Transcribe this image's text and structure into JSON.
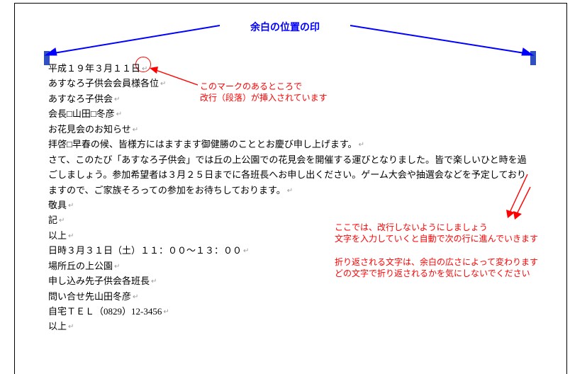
{
  "colors": {
    "blue": "#0000ff",
    "red": "#ff0000",
    "mark": "#3050c0"
  },
  "top_label": "余白の位置の印",
  "annotations": {
    "circle_note_l1": "このマークのあるところで",
    "circle_note_l2": "改行（段落）が挿入されています",
    "block_note_l1": "ここでは、改行しないようにしましょう",
    "block_note_l2": "文字を入力していくと自動で次の行に進んでいきます",
    "block_note_l3": "折り返される文字は、余白の広さによって変わります",
    "block_note_l4": "どの文字で折り返されるかを気にしないでください"
  },
  "icons": {
    "margin_mark": "margin-mark-icon",
    "return_mark": "↵"
  },
  "document": {
    "lines": {
      "l01": "平成１９年３月１１日",
      "l02": "あすなろ子供会会員様各位",
      "l03": "あすなろ子供会",
      "l04": "会長□山田□冬彦",
      "l05": "お花見会のお知らせ",
      "l06": "拝啓□早春の候、皆様方にはますます御健勝のこととお慶び申し上げます。",
      "l07": "さて、このたび「あすなろ子供会」では丘の上公園での花見会を開催する運びとなりました。皆で楽しいひと時を過ごしましょう。参加希望者は３月２５日までに各班長へお申し出ください。ゲーム大会や抽選会などを予定しておりますので、ご家族そろっての参加をお待ちしております。",
      "l08": "敬具",
      "l09": "記",
      "l10": "以上",
      "l11": "日時３月３１日（土）１１：００～１３：００",
      "l12": "場所丘の上公園",
      "l13": "申し込み先子供会各班長",
      "l14": "問い合せ先山田冬彦",
      "l15": "自宅ＴＥＬ（0829）12-3456",
      "l16": "以上"
    }
  }
}
